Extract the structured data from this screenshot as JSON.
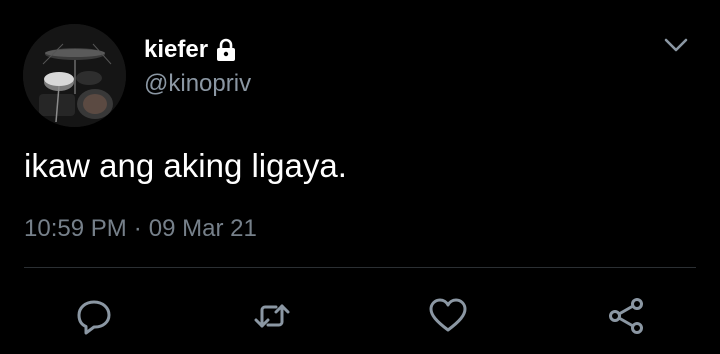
{
  "tweet": {
    "display_name": "kiefer",
    "handle": "@kinopriv",
    "text": "ikaw ang aking ligaya.",
    "time": "10:59 PM",
    "separator": "·",
    "date": "09 Mar 21"
  },
  "icons": {
    "lock": "lock-icon",
    "caret": "chevron-down-icon",
    "reply": "reply-icon",
    "retweet": "retweet-icon",
    "like": "heart-icon",
    "share": "share-icon"
  },
  "colors": {
    "background": "#000000",
    "text": "#ffffff",
    "secondary_text": "#8b97a3",
    "icon": "#8b97a3",
    "divider": "#2b2f33"
  }
}
